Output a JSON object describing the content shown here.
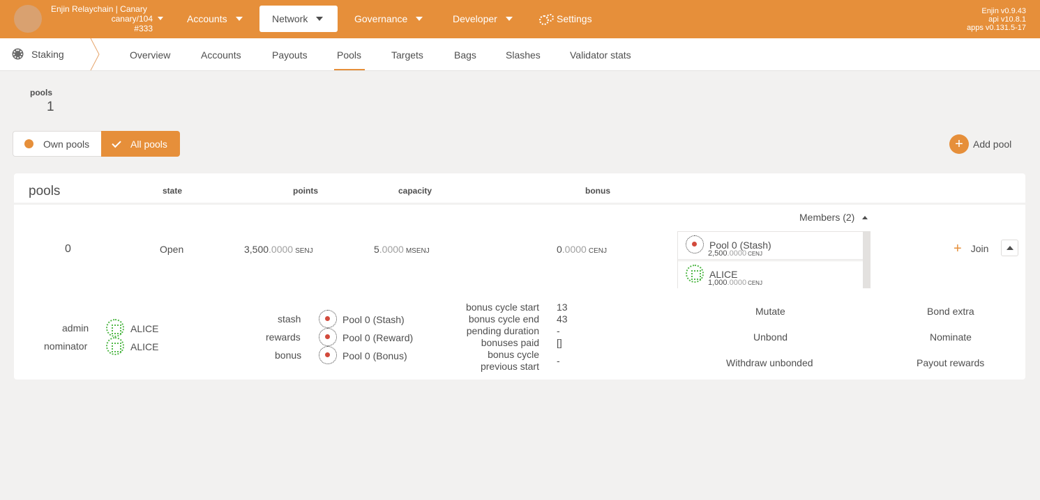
{
  "header": {
    "chain_name": "Enjin Relaychain | Canary",
    "chain_spec": "canary/104",
    "block": "#333",
    "nav": [
      {
        "label": "Accounts"
      },
      {
        "label": "Network"
      },
      {
        "label": "Governance"
      },
      {
        "label": "Developer"
      },
      {
        "label": "Settings"
      }
    ],
    "versions": [
      "Enjin v0.9.43",
      "api v10.8.1",
      "apps v0.131.5-17"
    ],
    "colors": {
      "accent": "#e68f3a"
    }
  },
  "subnav": {
    "section": "Staking",
    "tabs": [
      "Overview",
      "Accounts",
      "Payouts",
      "Pools",
      "Targets",
      "Bags",
      "Slashes",
      "Validator stats"
    ],
    "active_tab": "Pools"
  },
  "summary": {
    "label": "pools",
    "value": "1"
  },
  "toggle": {
    "own": "Own pools",
    "all": "All pools",
    "selected": "All pools"
  },
  "add_pool": "Add pool",
  "table": {
    "title": "pools",
    "columns": {
      "state": "state",
      "points": "points",
      "capacity": "capacity",
      "bonus": "bonus"
    }
  },
  "pool": {
    "id": "0",
    "state": "Open",
    "points": {
      "int": "3,500",
      "dec": ".0000",
      "unit": "SENJ"
    },
    "capacity": {
      "int": "5",
      "dec": ".0000",
      "unit": "MSENJ"
    },
    "bonus": {
      "int": "0",
      "dec": ".0000",
      "unit": "CENJ"
    },
    "members_label": "Members (2)",
    "members": [
      {
        "name": "Pool 0 (Stash)",
        "int": "2,500",
        "dec": ".0000",
        "unit": "CENJ",
        "icon": "polkadot-identicon"
      },
      {
        "name": "ALICE",
        "int": "1,000",
        "dec": ".0000",
        "unit": "CENJ",
        "icon": "alice-identicon"
      }
    ],
    "join": "Join",
    "roles": {
      "admin_label": "admin",
      "admin": "ALICE",
      "nominator_label": "nominator",
      "nominator": "ALICE"
    },
    "accounts": {
      "stash_label": "stash",
      "stash": "Pool 0 (Stash)",
      "rewards_label": "rewards",
      "rewards": "Pool 0 (Reward)",
      "bonus_label": "bonus",
      "bonus": "Pool 0 (Bonus)"
    },
    "cycle": {
      "start_label": "bonus cycle start",
      "start": "13",
      "end_label": "bonus cycle end",
      "end": "43",
      "pending_label": "pending duration",
      "pending": "-",
      "paid_label": "bonuses paid",
      "paid": "[]",
      "prev_label_1": "bonus cycle",
      "prev_label_2": "previous start",
      "prev": "-"
    },
    "actions": [
      "Mutate",
      "Bond extra",
      "Unbond",
      "Nominate",
      "Withdraw unbonded",
      "Payout rewards"
    ]
  }
}
